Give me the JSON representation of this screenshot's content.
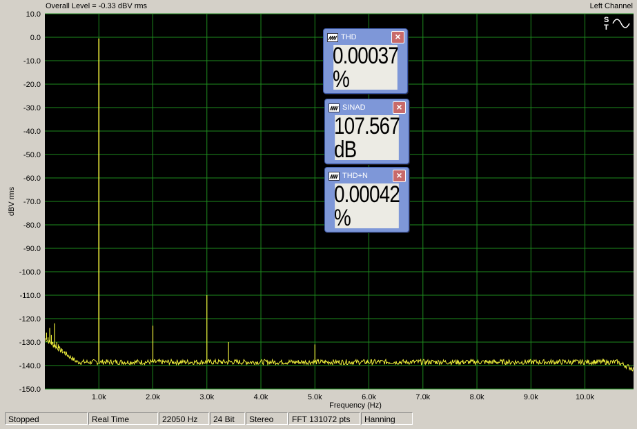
{
  "header": {
    "overall_level": "Overall Level = -0.33 dBV rms",
    "channel": "Left Channel"
  },
  "meters": [
    {
      "title": "THD",
      "value": "0.00037 %"
    },
    {
      "title": "SINAD",
      "value": "107.567 dB"
    },
    {
      "title": "THD+N",
      "value": "0.00042 %"
    }
  ],
  "status": {
    "state": "Stopped",
    "mode": "Real Time",
    "rate": "22050 Hz",
    "bits": "24 Bit",
    "channels": "Stereo",
    "fft": "FFT 131072 pts",
    "window": "Hanning"
  },
  "colors": {
    "plot_bg": "#000000",
    "grid": "#1e8c1e",
    "trace": "#f0f03c"
  },
  "chart_data": {
    "type": "line",
    "title": "",
    "xlabel": "Frequency (Hz)",
    "ylabel": "dBV rms",
    "xlim": [
      0,
      10900
    ],
    "ylim": [
      -150,
      10
    ],
    "x_ticks": [
      1000,
      2000,
      3000,
      4000,
      5000,
      6000,
      7000,
      8000,
      9000,
      10000
    ],
    "x_tick_labels": [
      "1.0k",
      "2.0k",
      "3.0k",
      "4.0k",
      "5.0k",
      "6.0k",
      "7.0k",
      "8.0k",
      "9.0k",
      "10.0k"
    ],
    "y_ticks": [
      10,
      0,
      -10,
      -20,
      -30,
      -40,
      -50,
      -60,
      -70,
      -80,
      -90,
      -100,
      -110,
      -120,
      -130,
      -140,
      -150
    ],
    "y_tick_labels": [
      "10.0",
      "0.0",
      "-10.0",
      "-20.0",
      "-30.0",
      "-40.0",
      "-50.0",
      "-60.0",
      "-70.0",
      "-80.0",
      "-90.0",
      "-100.0",
      "-110.0",
      "-120.0",
      "-130.0",
      "-140.0",
      "-150.0"
    ],
    "grid": true,
    "noise_floor": -138.5,
    "peaks": [
      {
        "x": 30,
        "y": -126
      },
      {
        "x": 60,
        "y": -128
      },
      {
        "x": 90,
        "y": -124
      },
      {
        "x": 120,
        "y": -127
      },
      {
        "x": 150,
        "y": -130
      },
      {
        "x": 180,
        "y": -122
      },
      {
        "x": 220,
        "y": -130
      },
      {
        "x": 250,
        "y": -131
      },
      {
        "x": 300,
        "y": -134
      },
      {
        "x": 320,
        "y": -133
      },
      {
        "x": 370,
        "y": -134
      },
      {
        "x": 450,
        "y": -136
      },
      {
        "x": 1000,
        "y": -0.5
      },
      {
        "x": 2000,
        "y": -123
      },
      {
        "x": 3000,
        "y": -110
      },
      {
        "x": 3400,
        "y": -130
      },
      {
        "x": 5000,
        "y": -131
      }
    ]
  }
}
